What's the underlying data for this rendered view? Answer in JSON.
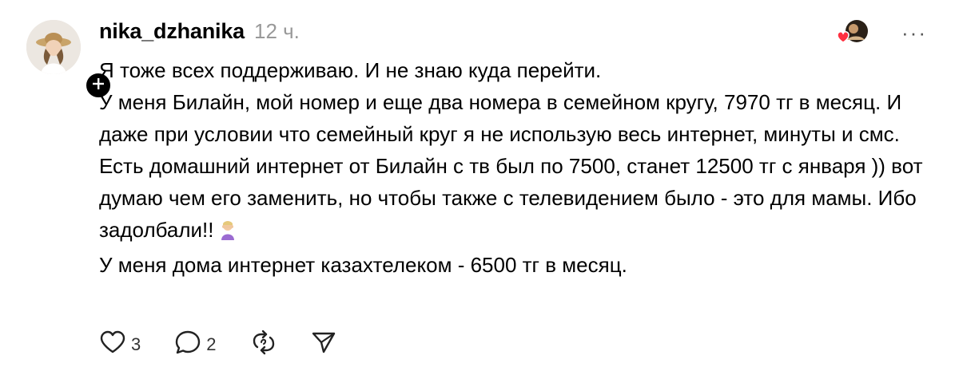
{
  "post": {
    "author": {
      "username": "nika_dzhanika",
      "avatar_icon": "avatar-photo"
    },
    "timestamp": "12 ч.",
    "follow_icon": "plus-icon",
    "reactions_icon": "liked-by-avatars-icon",
    "more_icon": "more-dots-icon",
    "more_label": "···",
    "body": {
      "p1": "Я тоже всех поддерживаю. И не знаю куда перейти.",
      "p2": "У меня Билайн, мой номер и еще два номера в семейном кругу, 7970 тг в месяц. И даже при условии что семейный круг я не использую весь интернет, минуты и смс.",
      "p3": "Есть домашний интернет от Билайн с тв был по 7500, станет 12500 тг с января )) вот думаю чем его заменить, но чтобы также с телевидением было - это для мамы. Ибо задолбали!!",
      "p3_emoji": "person-facepalming-emoji",
      "p4": "У меня дома интернет казахтелеком - 6500 тг в месяц."
    },
    "actions": {
      "like": {
        "icon": "heart-icon",
        "count": "3"
      },
      "reply": {
        "icon": "comment-icon",
        "count": "2"
      },
      "repost": {
        "icon": "repost-icon"
      },
      "share": {
        "icon": "share-icon"
      }
    },
    "colors": {
      "text": "#000000",
      "muted": "#999999",
      "heart_red": "#ff3040"
    }
  }
}
